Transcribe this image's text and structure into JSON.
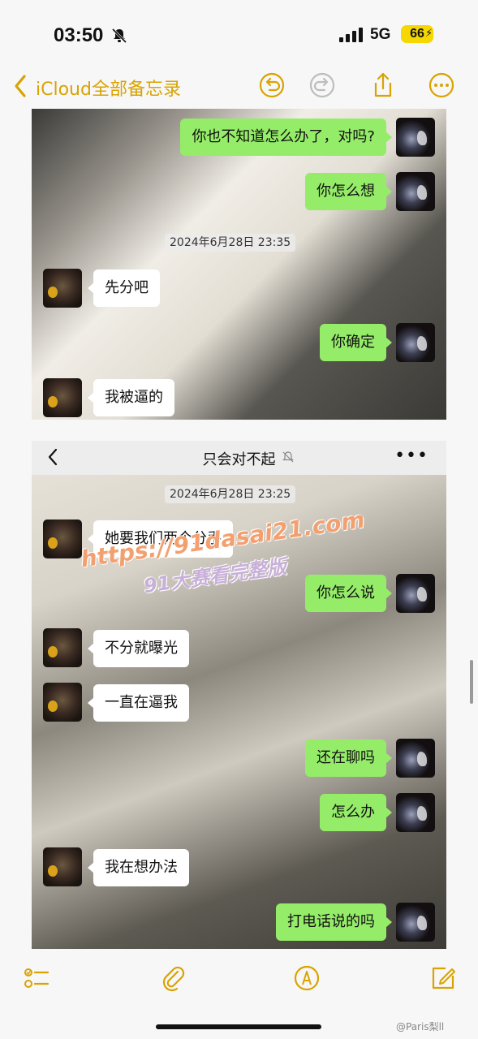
{
  "status_bar": {
    "time": "03:50",
    "network": "5G",
    "battery": "66",
    "icons": [
      "bell-slash-icon",
      "signal-bars-icon",
      "charging-bolt-icon"
    ]
  },
  "notes_nav": {
    "back_label": "iCloud全部备忘录",
    "accent_color": "#d9a300",
    "icons": [
      "undo-icon",
      "redo-icon",
      "share-icon",
      "more-icon"
    ]
  },
  "panel_top": {
    "messages": [
      {
        "side": "me",
        "text": "你也不知道怎么办了，对吗?"
      },
      {
        "side": "me",
        "text": "你怎么想"
      },
      {
        "type": "time",
        "text": "2024年6月28日 23:35"
      },
      {
        "side": "other",
        "text": "先分吧"
      },
      {
        "side": "me",
        "text": "你确定"
      },
      {
        "side": "other",
        "text": "我被逼的"
      }
    ]
  },
  "panel_bottom": {
    "chat_title": "只会对不起",
    "more_label": "•••",
    "messages": [
      {
        "type": "time",
        "text": "2024年6月28日 23:25"
      },
      {
        "side": "other",
        "text": "她要我们两个分手"
      },
      {
        "side": "me",
        "text": "你怎么说"
      },
      {
        "side": "other",
        "text": "不分就曝光"
      },
      {
        "side": "other",
        "text": "一直在逼我"
      },
      {
        "side": "me",
        "text": "还在聊吗"
      },
      {
        "side": "me",
        "text": "怎么办"
      },
      {
        "side": "other",
        "text": "我在想办法"
      },
      {
        "side": "me",
        "text": "打电话说的吗"
      }
    ]
  },
  "watermark": {
    "url": "https://91dasai21.com",
    "sub": "91大赛看完整版"
  },
  "toolbar": {
    "icons": [
      "checklist-icon",
      "paperclip-icon",
      "markup-pen-icon",
      "compose-icon"
    ]
  },
  "footer": {
    "weibo_credit": "@Paris梨ll"
  },
  "colors": {
    "green_bubble": "#95ec69",
    "white_bubble": "#ffffff",
    "notes_accent": "#d9a300"
  }
}
